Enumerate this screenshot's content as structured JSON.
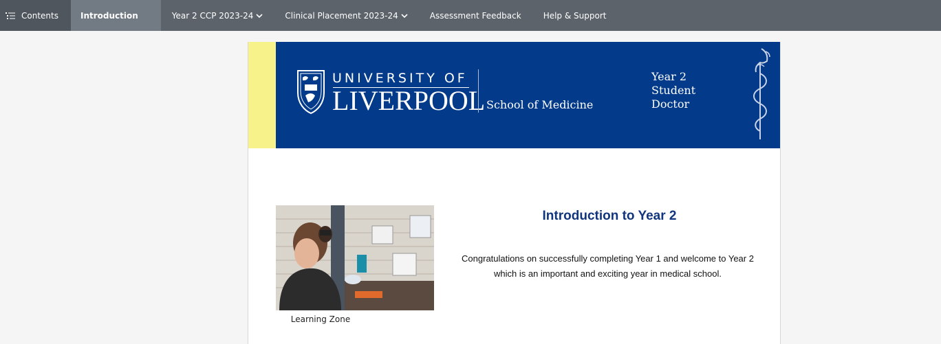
{
  "nav": {
    "contents_label": "Contents",
    "introduction_label": "Introduction",
    "year2_label": "Year 2 CCP 2023-24",
    "clinical_label": "Clinical Placement 2023-24",
    "assessment_label": "Assessment Feedback",
    "help_label": "Help & Support",
    "chevron_icon": "chevron-down-icon",
    "contents_icon": "list-tree-icon"
  },
  "banner": {
    "university_top": "UNIVERSITY OF",
    "university_bottom": "LIVERPOOL",
    "school": "School of Medicine",
    "year_lines": [
      "Year 2",
      "Student",
      "Doctor"
    ],
    "background_color": "#033b8a",
    "accent_stripe_color": "#f7f38a"
  },
  "main": {
    "photo_caption": "Learning Zone",
    "title": "Introduction to Year 2",
    "paragraph": "Congratulations on successfully completing Year 1 and welcome to Year 2 which is an important and exciting year in medical school."
  }
}
